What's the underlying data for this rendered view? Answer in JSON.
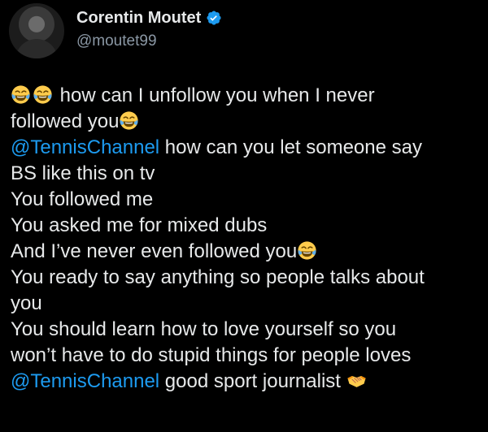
{
  "author": {
    "name": "Corentin Moutet",
    "handle": "@moutet99",
    "verified": true
  },
  "tweet": {
    "lines": [
      {
        "emoji_before": [
          "laughing-tears-emoji",
          "laughing-tears-emoji"
        ],
        "text": " how can I unfollow you when I never"
      },
      {
        "text": "followed you",
        "emoji_after": [
          "laughing-tears-emoji"
        ]
      },
      {
        "mention": "@TennisChannel",
        "text": " how can you let someone say"
      },
      {
        "text": "BS like this on tv"
      },
      {
        "text": "You followed me"
      },
      {
        "text": "You asked me for mixed dubs"
      },
      {
        "text": "And I’ve never even followed you",
        "emoji_after": [
          "laughing-tears-emoji"
        ]
      },
      {
        "text": "You ready to say anything so people talks about"
      },
      {
        "text": "you"
      },
      {
        "text": "You should learn how to love yourself so you"
      },
      {
        "text": "won’t have to do stupid things for people loves"
      },
      {
        "mention": "@TennisChannel",
        "text": " good sport journalist ",
        "emoji_after": [
          "handshake-emoji"
        ]
      }
    ]
  },
  "colors": {
    "background": "#000000",
    "text": "#e7e9ea",
    "secondary": "#8b98a5",
    "accent": "#1d9bf0"
  }
}
